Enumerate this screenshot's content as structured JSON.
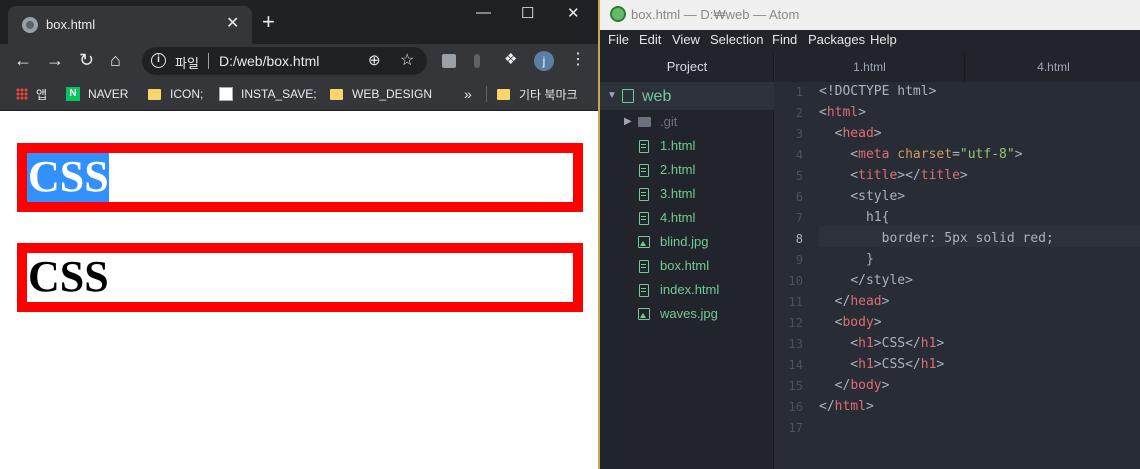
{
  "browser": {
    "tab_title": "box.html",
    "tab_close": "✕",
    "new_tab": "+",
    "window_buttons": {
      "minimize": "—",
      "maximize": "☐",
      "close": "✕"
    },
    "scheme_label": "파일",
    "url": "D:/web/box.html",
    "avatar_letter": "j",
    "bookmarks": [
      {
        "label": "앱"
      },
      {
        "label": "NAVER"
      },
      {
        "label": "ICON;"
      },
      {
        "label": "INSTA_SAVE;"
      },
      {
        "label": "WEB_DESIGN"
      }
    ],
    "more_bookmarks": "»",
    "other_bookmarks": "기타 북마크",
    "page": {
      "headings": [
        {
          "text": "CSS",
          "selected": true
        },
        {
          "text": "CSS",
          "selected": false
        }
      ],
      "border_color": "#ff0000",
      "selection_color": "#3390ff"
    }
  },
  "atom": {
    "window_title": "box.html — D:₩web — Atom",
    "menu": [
      "File",
      "Edit",
      "View",
      "Selection",
      "Find",
      "Packages",
      "Help"
    ],
    "tree": {
      "header": "Project",
      "root": "web",
      "items": [
        {
          "name": ".git",
          "kind": "folder"
        },
        {
          "name": "1.html",
          "kind": "file"
        },
        {
          "name": "2.html",
          "kind": "file"
        },
        {
          "name": "3.html",
          "kind": "file"
        },
        {
          "name": "4.html",
          "kind": "file"
        },
        {
          "name": "blind.jpg",
          "kind": "image"
        },
        {
          "name": "box.html",
          "kind": "file"
        },
        {
          "name": "index.html",
          "kind": "file"
        },
        {
          "name": "waves.jpg",
          "kind": "image"
        }
      ]
    },
    "tabs": [
      "1.html",
      "4.html"
    ],
    "current_line": 8,
    "lines": [
      "1",
      "2",
      "3",
      "4",
      "5",
      "6",
      "7",
      "8",
      "9",
      "10",
      "11",
      "12",
      "13",
      "14",
      "15",
      "16",
      "17"
    ],
    "code": {
      "l1": "<!DOCTYPE html>",
      "l2_t": "html",
      "l3_t": "head",
      "l4_t": "meta",
      "l4_a": "charset",
      "l4_v": "\"utf-8\"",
      "l5_t": "title",
      "l6": "<style>",
      "l7": "h1{",
      "l8": "border: 5px solid red;",
      "l9": "}",
      "l10": "</style>",
      "l11_t": "head",
      "l12_t": "body",
      "l13_t": "h1",
      "l13_c": "CSS",
      "l14_t": "h1",
      "l14_c": "CSS",
      "l15_t": "body",
      "l16_t": "html"
    },
    "colors": {
      "tag": "#e06c75",
      "attr": "#d19a66",
      "string": "#98c379",
      "tree_text": "#73c991"
    }
  }
}
